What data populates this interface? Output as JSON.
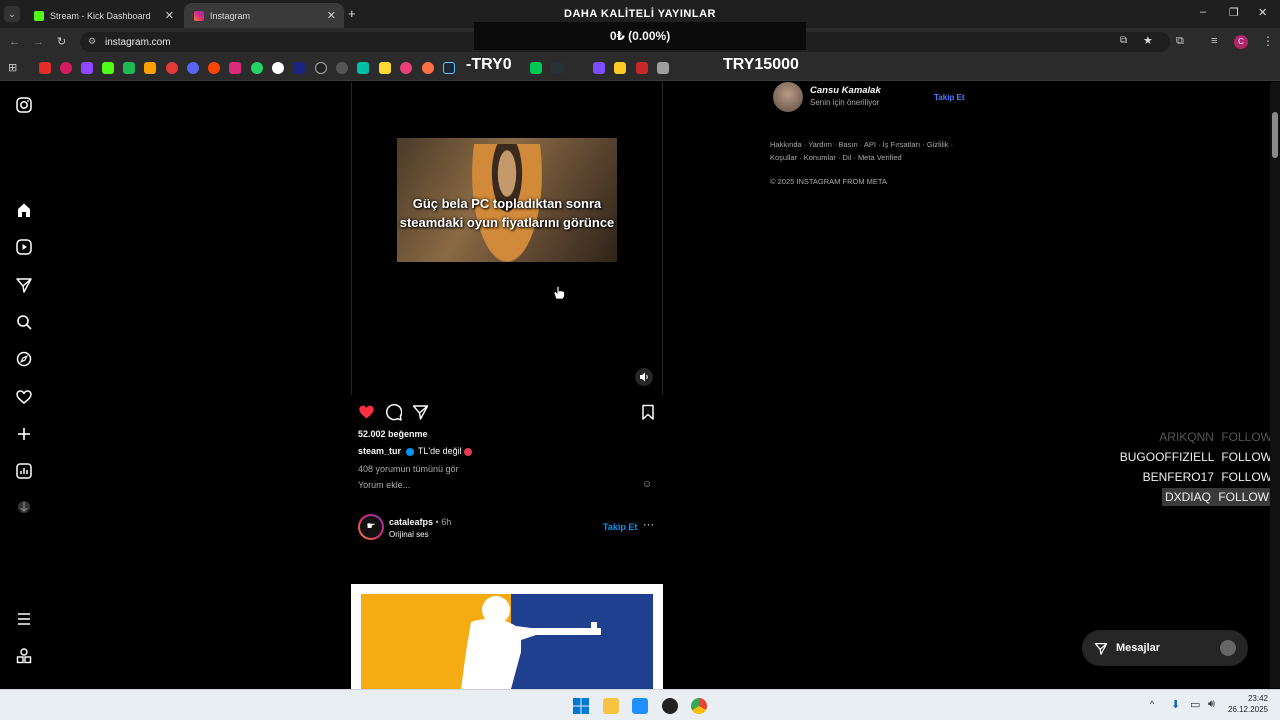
{
  "browser": {
    "tabs": [
      {
        "label": "Stream - Kick Dashboard",
        "active": false
      },
      {
        "label": "Instagram",
        "active": true
      }
    ],
    "url": "instagram.com",
    "profile_initial": "C"
  },
  "overlay": {
    "stream_title": "DAHA KALİTELİ YAYINLAR",
    "progress": "0₺ (0.00%)",
    "ticker_left": "-TRY0",
    "ticker_right": "TRY15000"
  },
  "suggestion": {
    "username": "Cansu Kamalak",
    "subtitle": "Senin için öneriliyor",
    "follow": "Takip Et"
  },
  "footer": {
    "links": "Hakkında · Yardım · Basın · API · İş Fırsatları · Gizlilik · Koşullar · Konumlar · Dil · Meta Verified",
    "copyright": "© 2025 INSTAGRAM FROM META"
  },
  "post1": {
    "meme_caption": "Güç bela PC topladıktan sonra steamdaki oyun fiyatlarını görünce",
    "likes": "52.002 beğenme",
    "author": "steam_tur",
    "caption": "TL'de değil",
    "comments": "408 yorumun tümünü gör",
    "comment_placeholder": "Yorum ekle..."
  },
  "post2": {
    "author": "cataleafps",
    "time": "• 6h",
    "audio": "Orijinal ses",
    "follow": "Takip Et"
  },
  "follow_list": [
    {
      "name": "ARIKQNN",
      "action": "FOLLOW",
      "faded": true
    },
    {
      "name": "BUGOOFFIZIELL",
      "action": "FOLLOW",
      "faded": false
    },
    {
      "name": "BENFERO17",
      "action": "FOLLOW",
      "faded": false
    },
    {
      "name": "DXDIAQ",
      "action": "FOLLOW",
      "faded": false,
      "highlight": true
    }
  ],
  "messages": {
    "label": "Mesajlar"
  },
  "clock": {
    "time": "23:42",
    "date": "26.12.2025"
  },
  "colors": {
    "like_red": "#ff3040",
    "link_blue": "#0095f6",
    "kick_green": "#53fc18"
  }
}
